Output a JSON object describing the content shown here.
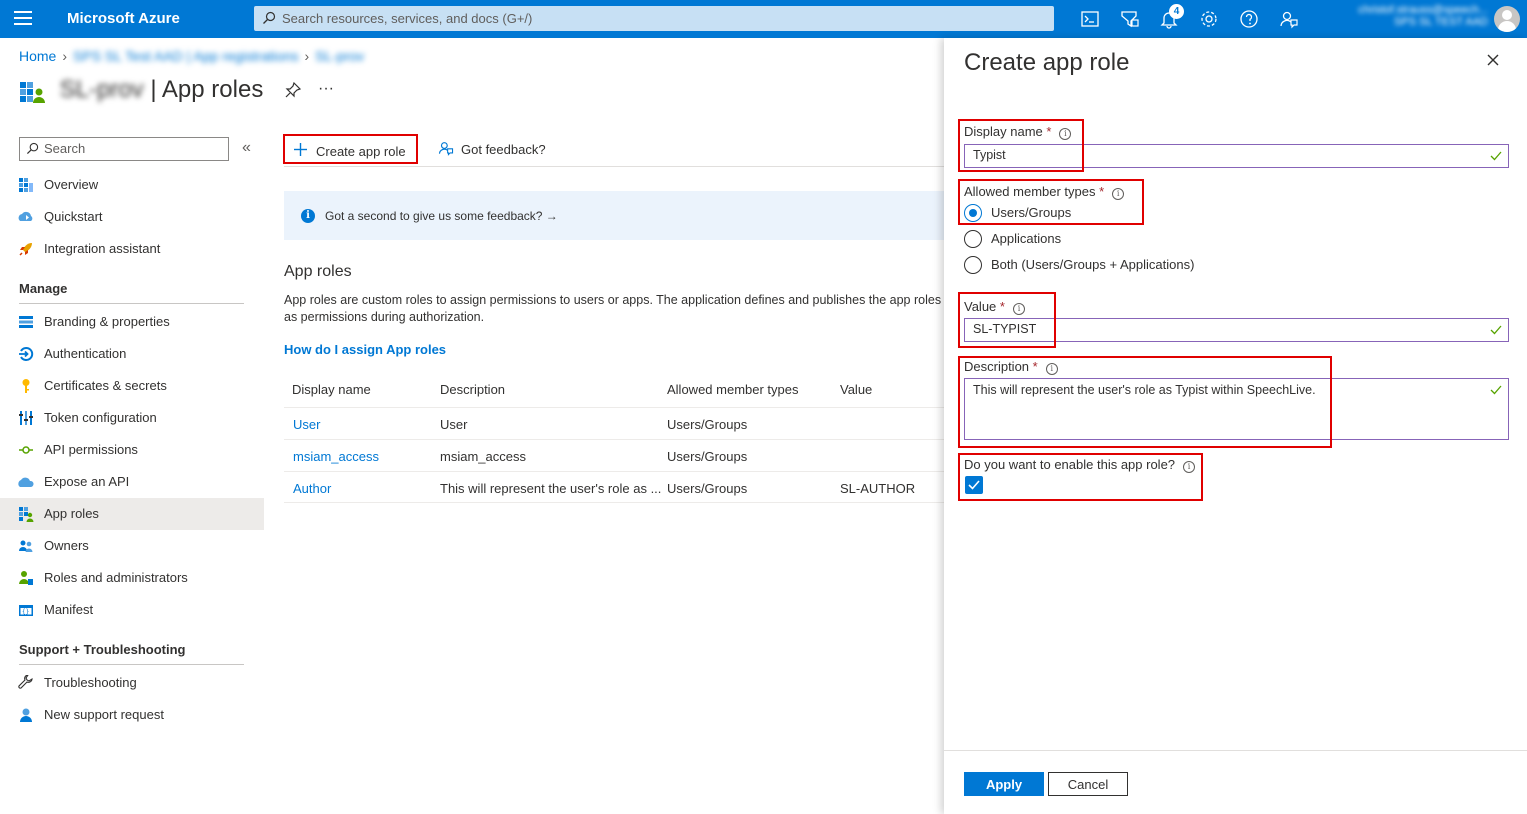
{
  "topbar": {
    "brand": "Microsoft Azure",
    "search_placeholder": "Search resources, services, and docs (G+/)",
    "notifications_count": "4",
    "account_line1": "christof.strauss@speech...",
    "account_line2": "SPS SL TEST AAD",
    "colors": {
      "bar": "#0078d4",
      "search": "#c7e0f4"
    },
    "icons": [
      "cloud-shell-icon",
      "directory-filter-icon",
      "notifications-icon",
      "settings-icon",
      "help-icon",
      "feedback-icon"
    ]
  },
  "breadcrumb": {
    "home": "Home",
    "tenant": "SPS SL Test AAD | App registrations",
    "app": "SL-prov"
  },
  "page": {
    "app_name": "SL-prov",
    "separator": "|",
    "title": "App roles",
    "more": "···"
  },
  "sidebar": {
    "search_placeholder": "Search",
    "collapse": "«",
    "top_items": [
      {
        "label": "Overview",
        "icon": "overview-icon"
      },
      {
        "label": "Quickstart",
        "icon": "quickstart-icon"
      },
      {
        "label": "Integration assistant",
        "icon": "rocket-icon"
      }
    ],
    "manage_header": "Manage",
    "manage_items": [
      {
        "label": "Branding & properties",
        "icon": "branding-icon"
      },
      {
        "label": "Authentication",
        "icon": "authentication-icon"
      },
      {
        "label": "Certificates & secrets",
        "icon": "key-icon"
      },
      {
        "label": "Token configuration",
        "icon": "token-icon"
      },
      {
        "label": "API permissions",
        "icon": "api-permissions-icon"
      },
      {
        "label": "Expose an API",
        "icon": "cloud-api-icon"
      },
      {
        "label": "App roles",
        "icon": "app-roles-icon",
        "active": true
      },
      {
        "label": "Owners",
        "icon": "owners-icon"
      },
      {
        "label": "Roles and administrators",
        "icon": "roles-icon"
      },
      {
        "label": "Manifest",
        "icon": "manifest-icon"
      }
    ],
    "support_header": "Support + Troubleshooting",
    "support_items": [
      {
        "label": "Troubleshooting",
        "icon": "wrench-icon"
      },
      {
        "label": "New support request",
        "icon": "support-icon"
      }
    ]
  },
  "commands": {
    "create": "Create app role",
    "feedback": "Got feedback?"
  },
  "banner": {
    "text": "Got a second to give us some feedback? →"
  },
  "main": {
    "section_title": "App roles",
    "description_line1": "App roles are custom roles to assign permissions to users or apps. The application defines and publishes the app roles and interprets them",
    "description_line2": "as permissions during authorization.",
    "link": "How do I assign App roles",
    "table": {
      "headers": [
        "Display name",
        "Description",
        "Allowed member types",
        "Value"
      ],
      "rows": [
        {
          "name": "User",
          "description": "User",
          "types": "Users/Groups",
          "value": ""
        },
        {
          "name": "msiam_access",
          "description": "msiam_access",
          "types": "Users/Groups",
          "value": ""
        },
        {
          "name": "Author",
          "description": "This will represent the user's role as ...",
          "types": "Users/Groups",
          "value": "SL-AUTHOR"
        }
      ]
    }
  },
  "panel": {
    "title": "Create app role",
    "display_name_label": "Display name",
    "display_name_value": "Typist",
    "member_types_label": "Allowed member types",
    "member_types_options": [
      {
        "label": "Users/Groups",
        "selected": true
      },
      {
        "label": "Applications",
        "selected": false
      },
      {
        "label": "Both (Users/Groups + Applications)",
        "selected": false
      }
    ],
    "value_label": "Value",
    "value_value": "SL-TYPIST",
    "description_label": "Description",
    "description_value": "This will represent the user's role as Typist within SpeechLive.",
    "enable_label": "Do you want to enable this app role?",
    "enable_checked": true,
    "required_mark": "*",
    "apply": "Apply",
    "cancel": "Cancel",
    "colors": {
      "accent": "#0078d4",
      "highlight": "#e00000",
      "field_border": "#8764b8"
    }
  }
}
